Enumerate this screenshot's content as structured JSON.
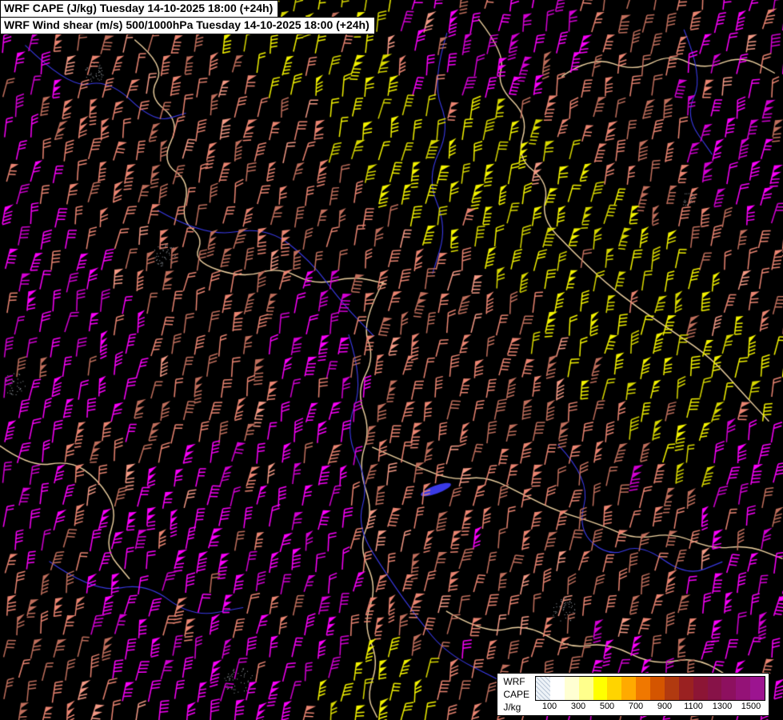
{
  "titles": {
    "line1": "WRF CAPE (J/kg) Tuesday 14-10-2025 18:00 (+24h)",
    "line2": "WRF Wind shear (m/s) 500/1000hPa Tuesday 14-10-2025 18:00 (+24h)"
  },
  "legend": {
    "model": "WRF",
    "param": "CAPE",
    "unit": "J/kg",
    "ticks": [
      "100",
      "300",
      "500",
      "700",
      "900",
      "1100",
      "1300",
      "1500"
    ],
    "colors": [
      {
        "hatch": true,
        "color": "#eef3f8"
      },
      {
        "color": "#ffffff"
      },
      {
        "color": "#ffffd2"
      },
      {
        "color": "#ffff8c"
      },
      {
        "color": "#ffff00"
      },
      {
        "color": "#ffd400"
      },
      {
        "color": "#ffaa00"
      },
      {
        "color": "#f07800"
      },
      {
        "color": "#d45500"
      },
      {
        "color": "#b13a10"
      },
      {
        "color": "#9a2121"
      },
      {
        "color": "#8c1535"
      },
      {
        "color": "#871248"
      },
      {
        "color": "#8d105f"
      },
      {
        "color": "#941277"
      },
      {
        "color": "#9c1490"
      }
    ]
  },
  "map": {
    "palette": {
      "background": "#000000",
      "border": "#f0d3a2",
      "river": "#3a3ae6",
      "barb_yellow": "#f2f200",
      "barb_yellow_dim": "#d8d800",
      "barb_salmon": "#ea8572",
      "barb_salmon_dark": "#c06f5d",
      "barb_salmon_light": "#f49a86",
      "barb_magenta": "#fa00fa",
      "barb_magenta_dark": "#d400d4"
    }
  }
}
